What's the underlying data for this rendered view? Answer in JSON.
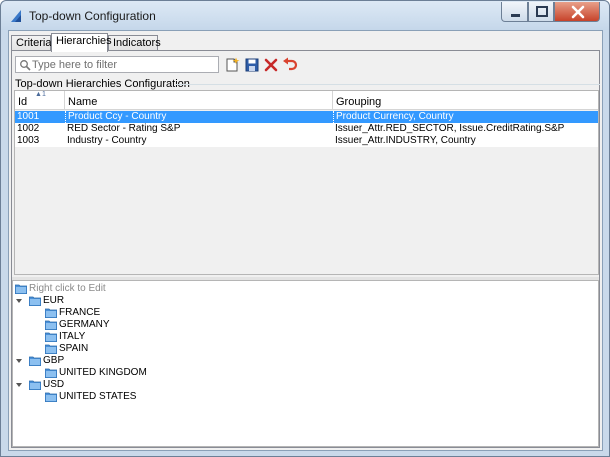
{
  "window": {
    "title": "Top-down Configuration"
  },
  "tabs": [
    {
      "label": "Criteria"
    },
    {
      "label": "Hierarchies"
    },
    {
      "label": "Indicators"
    }
  ],
  "filter": {
    "placeholder": "Type here to filter",
    "value": ""
  },
  "toolbar": [
    {
      "icon": "new-item-icon"
    },
    {
      "icon": "save-icon"
    },
    {
      "icon": "delete-icon"
    },
    {
      "icon": "undo-icon"
    }
  ],
  "config": {
    "title": "Top-down Hierarchies Configuration",
    "sort_indicator": "1",
    "columns": [
      "Id",
      "Name",
      "Grouping"
    ],
    "rows": [
      {
        "id": "1001",
        "name": "Product Ccy - Country",
        "grouping": "Product Currency, Country"
      },
      {
        "id": "1002",
        "name": "RED Sector - Rating S&P",
        "grouping": "Issuer_Attr.RED_SECTOR, Issue.CreditRating.S&P"
      },
      {
        "id": "1003",
        "name": "Industry - Country",
        "grouping": "Issuer_Attr.INDUSTRY, Country"
      }
    ]
  },
  "tree": {
    "root_hint": "Right click to Edit",
    "nodes": [
      {
        "label": "EUR",
        "children": [
          "FRANCE",
          "GERMANY",
          "ITALY",
          "SPAIN"
        ]
      },
      {
        "label": "GBP",
        "children": [
          "UNITED KINGDOM"
        ]
      },
      {
        "label": "USD",
        "children": [
          "UNITED STATES"
        ]
      }
    ]
  },
  "colors": {
    "selection": "#3399ff",
    "folder": "#4a90d9",
    "delete": "#c62828",
    "undo": "#d9432f"
  }
}
